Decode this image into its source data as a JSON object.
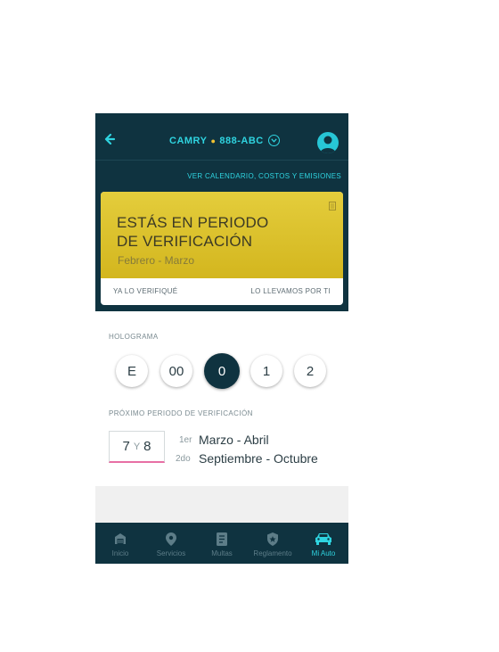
{
  "header": {
    "car_model": "CAMRY",
    "plate": "888-ABC",
    "calendar_link": "VER CALENDARIO, COSTOS  Y EMISIONES"
  },
  "status_card": {
    "title_line1": "ESTÁS EN PERIODO",
    "title_line2": "DE VERIFICACIÓN",
    "period": "Febrero - Marzo",
    "btn_verified": "YA LO VERIFIQUÉ",
    "btn_take": "LO LLEVAMOS POR TI"
  },
  "hologram": {
    "label": "HOLOGRAMA",
    "options": [
      "E",
      "00",
      "0",
      "1",
      "2"
    ],
    "selected": "0"
  },
  "next_period": {
    "label": "PRÓXIMO PERIODO DE VERIFICACIÓN",
    "digit_a": "7",
    "joiner": "Y",
    "digit_b": "8",
    "first_ord": "1er",
    "first_range": "Marzo - Abril",
    "second_ord": "2do",
    "second_range": "Septiembre - Octubre"
  },
  "tabs": [
    {
      "label": "Inicio",
      "icon": "garage-icon"
    },
    {
      "label": "Servicios",
      "icon": "location-pin-icon"
    },
    {
      "label": "Multas",
      "icon": "ticket-icon"
    },
    {
      "label": "Reglamento",
      "icon": "badge-icon"
    },
    {
      "label": "Mi Auto",
      "icon": "car-icon"
    }
  ],
  "active_tab": "Mi Auto",
  "colors": {
    "header_bg": "#0f3340",
    "accent": "#2fd4e0",
    "card_yellow": "#dcc22b",
    "highlight_pink": "#e86fa4"
  }
}
